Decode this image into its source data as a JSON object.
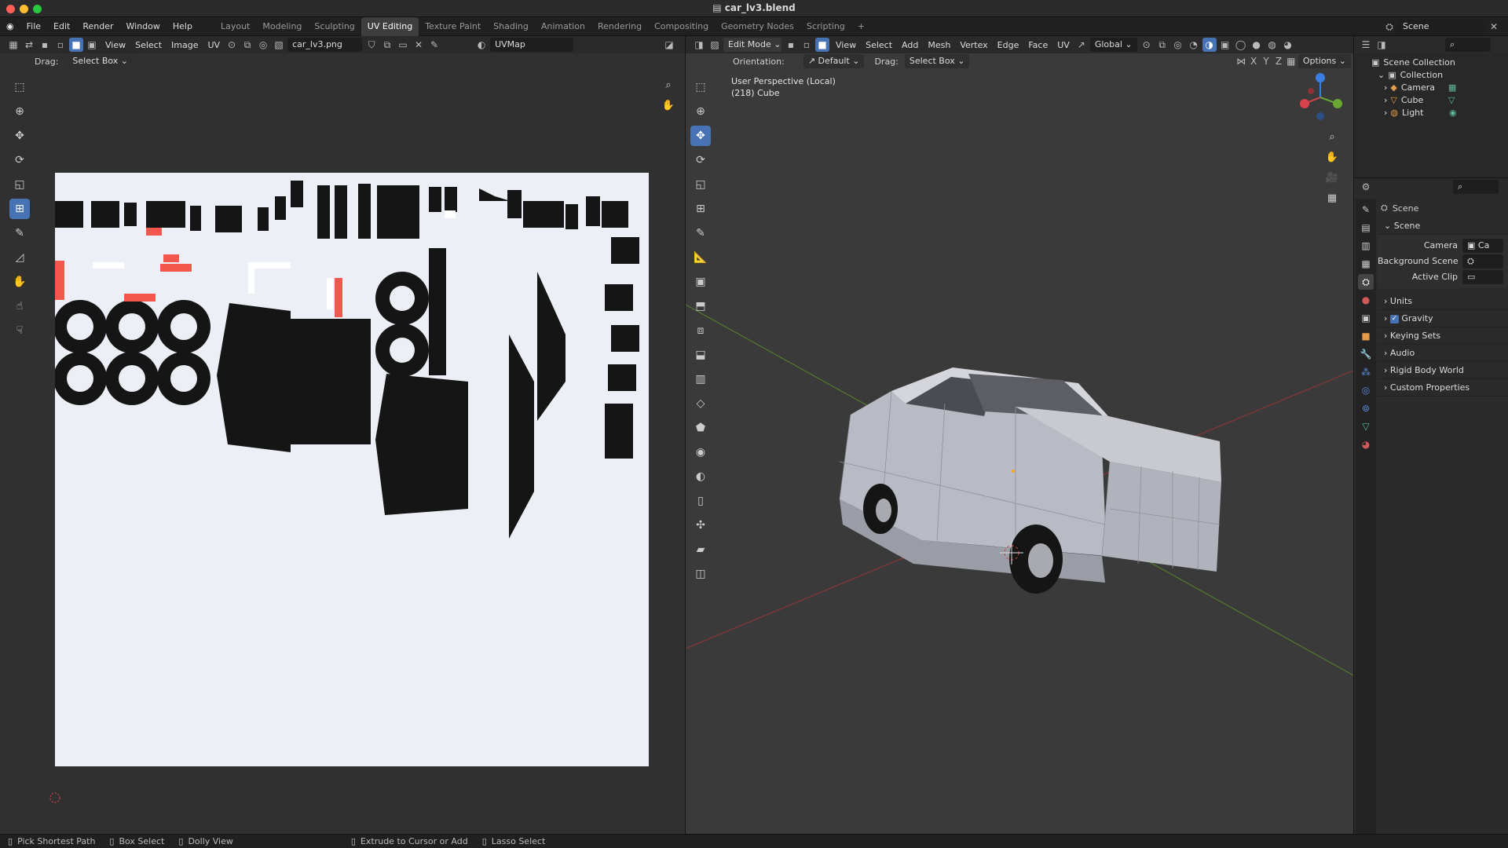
{
  "window": {
    "title": "car_lv3.blend"
  },
  "menu": {
    "file": "File",
    "edit": "Edit",
    "render": "Render",
    "window": "Window",
    "help": "Help"
  },
  "workspaces": [
    "Layout",
    "Modeling",
    "Sculpting",
    "UV Editing",
    "Texture Paint",
    "Shading",
    "Animation",
    "Rendering",
    "Compositing",
    "Geometry Nodes",
    "Scripting"
  ],
  "scene_selector": "Scene",
  "uv_editor": {
    "menus": {
      "view": "View",
      "select": "Select",
      "image": "Image",
      "uv": "UV"
    },
    "image_name": "car_lv3.png",
    "uvmap": "UVMap",
    "drag_label": "Drag:",
    "drag_value": "Select Box"
  },
  "viewport": {
    "mode": "Edit Mode",
    "menus": {
      "view": "View",
      "select": "Select",
      "add": "Add",
      "mesh": "Mesh",
      "vertex": "Vertex",
      "edge": "Edge",
      "face": "Face",
      "uv": "UV"
    },
    "transform": "Global",
    "orientation_label": "Orientation:",
    "orientation_value": "Default",
    "drag_label": "Drag:",
    "drag_value": "Select Box",
    "options": "Options",
    "axis_x": "X",
    "axis_y": "Y",
    "axis_z": "Z",
    "perspective": "User Perspective (Local)",
    "object_info": "(218) Cube"
  },
  "outliner": {
    "scene_collection": "Scene Collection",
    "collection": "Collection",
    "items": [
      {
        "label": "Camera"
      },
      {
        "label": "Cube"
      },
      {
        "label": "Light"
      }
    ]
  },
  "properties": {
    "header": "Scene",
    "section_scene": "Scene",
    "camera_label": "Camera",
    "camera_value": "Ca",
    "background_scene_label": "Background Scene",
    "active_clip_label": "Active Clip",
    "sections": [
      "Units",
      "Gravity",
      "Keying Sets",
      "Audio",
      "Rigid Body World",
      "Custom Properties"
    ]
  },
  "statusbar": {
    "pick_shortest_path": "Pick Shortest Path",
    "box_select": "Box Select",
    "dolly_view": "Dolly View",
    "extrude": "Extrude to Cursor or Add",
    "lasso_select": "Lasso Select"
  },
  "colors": {
    "accent": "#4772b3",
    "uv_island": "#151515",
    "uv_highlight": "#f2564d",
    "uv_bg": "#eceff5",
    "viewport_bg": "#3a3a3a"
  }
}
